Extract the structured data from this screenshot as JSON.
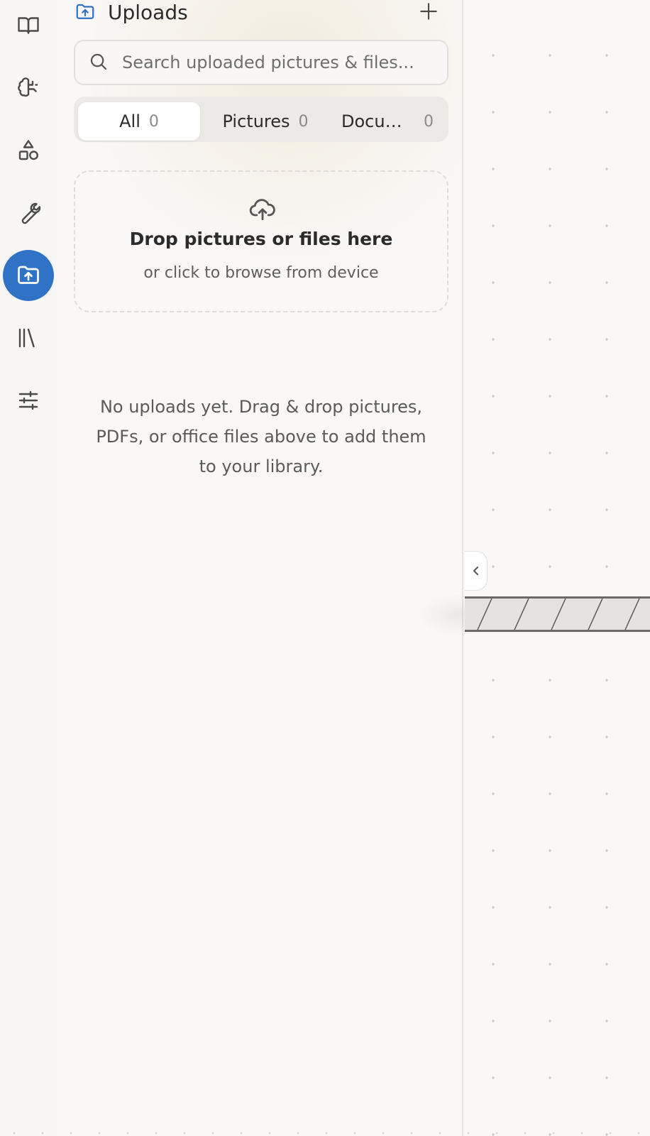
{
  "rail": {
    "items": [
      {
        "icon": "book-open-icon",
        "active": false
      },
      {
        "icon": "brain-icon",
        "active": false
      },
      {
        "icon": "shapes-icon",
        "active": false
      },
      {
        "icon": "wrench-icon",
        "active": false
      },
      {
        "icon": "folder-upload-icon",
        "active": true
      },
      {
        "icon": "library-icon",
        "active": false
      },
      {
        "icon": "sliders-icon",
        "active": false
      }
    ],
    "accent_color": "#2f72c6"
  },
  "panel": {
    "title": "Uploads",
    "search": {
      "placeholder": "Search uploaded pictures & files..."
    },
    "tabs": [
      {
        "label": "All",
        "count": "0",
        "active": true
      },
      {
        "label": "Pictures",
        "count": "0",
        "active": false
      },
      {
        "label": "Documents",
        "count": "0",
        "active": false
      }
    ],
    "dropzone": {
      "title": "Drop pictures or files here",
      "subtitle": "or click to browse from device"
    },
    "empty_message": "No uploads yet. Drag & drop pictures, PDFs, or office files above to add them to your library."
  }
}
